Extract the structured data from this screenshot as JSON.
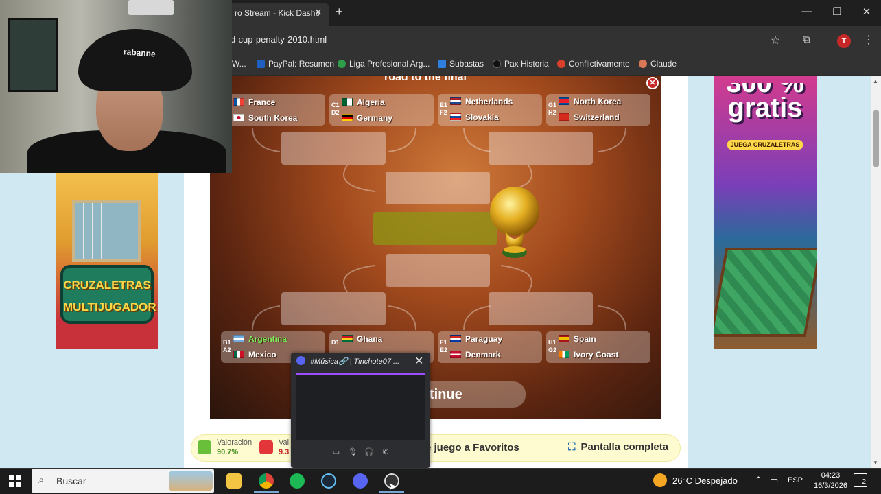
{
  "browser": {
    "tab_title": "ro Stream - Kick Dashb",
    "url": "d-cup-penalty-2010.html",
    "avatar_letter": "T",
    "bookmarks": [
      {
        "label": "W...",
        "color": "#444444"
      },
      {
        "label": "PayPal: Resumen",
        "color": "#1f5fbf"
      },
      {
        "label": "Liga Profesional Arg...",
        "color": "#2e9e4a"
      },
      {
        "label": "Subastas",
        "color": "#2f7fe0"
      },
      {
        "label": "Pax Historia",
        "color": "#111111"
      },
      {
        "label": "Conflictivamente",
        "color": "#d8402b"
      },
      {
        "label": "Claude",
        "color": "#d97757"
      }
    ]
  },
  "webcam": {
    "hat_text": "rabanne"
  },
  "ads": {
    "left": {
      "line1": "CRUZALETRAS",
      "line2": "MULTIJUGADOR"
    },
    "right": {
      "big1": "300 %",
      "big2": "gratis",
      "small": "JUEGA CRUZALETRAS"
    }
  },
  "game": {
    "title": "road to the final",
    "continue_label": "tinue",
    "top_matches": [
      {
        "codes": [
          "",
          ""
        ],
        "teams": [
          {
            "name": "France",
            "flag": "fr",
            "win": false
          },
          {
            "name": "South Korea",
            "flag": "kr",
            "win": false
          }
        ]
      },
      {
        "codes": [
          "C1",
          "D2"
        ],
        "teams": [
          {
            "name": "Algeria",
            "flag": "dz",
            "win": false
          },
          {
            "name": "Germany",
            "flag": "de",
            "win": false
          }
        ]
      },
      {
        "codes": [
          "E1",
          "F2"
        ],
        "teams": [
          {
            "name": "Netherlands",
            "flag": "nl",
            "win": false
          },
          {
            "name": "Slovakia",
            "flag": "sk",
            "win": false
          }
        ]
      },
      {
        "codes": [
          "G1",
          "H2"
        ],
        "teams": [
          {
            "name": "North Korea",
            "flag": "kp",
            "win": false
          },
          {
            "name": "Switzerland",
            "flag": "ch",
            "win": false
          }
        ]
      }
    ],
    "bottom_matches": [
      {
        "codes": [
          "B1",
          "A2"
        ],
        "teams": [
          {
            "name": "Argentina",
            "flag": "ar",
            "win": true
          },
          {
            "name": "Mexico",
            "flag": "mx",
            "win": false
          }
        ]
      },
      {
        "codes": [
          "",
          "D1"
        ],
        "teams": [
          {
            "name": "Ghana",
            "flag": "gh",
            "win": false
          },
          {
            "name": "",
            "flag": "",
            "win": false
          }
        ]
      },
      {
        "codes": [
          "F1",
          "E2"
        ],
        "teams": [
          {
            "name": "Paraguay",
            "flag": "py",
            "win": false
          },
          {
            "name": "Denmark",
            "flag": "dk",
            "win": false
          }
        ]
      },
      {
        "codes": [
          "H1",
          "G2"
        ],
        "teams": [
          {
            "name": "Spain",
            "flag": "es",
            "win": false
          },
          {
            "name": "Ivory Coast",
            "flag": "ci",
            "win": false
          }
        ]
      }
    ]
  },
  "ratings": {
    "like_label": "Valoración",
    "like_value": "90.7%",
    "dislike_label": "Val",
    "dislike_value": "9.3",
    "favorites_label": "e juego a Favoritos",
    "fullscreen_label": "Pantalla completa"
  },
  "discord": {
    "title": "#Música🔗 | Tinchote07 ..."
  },
  "taskbar": {
    "search_placeholder": "Buscar",
    "weather": "26°C  Despejado",
    "lang": "ESP",
    "time": "04:23",
    "date": "16/3/2026",
    "notif_count": "2"
  },
  "colors": {
    "game_accent": "#a24a1d",
    "winner_green": "#7cf05a",
    "page_bg": "#cfe8f2"
  }
}
